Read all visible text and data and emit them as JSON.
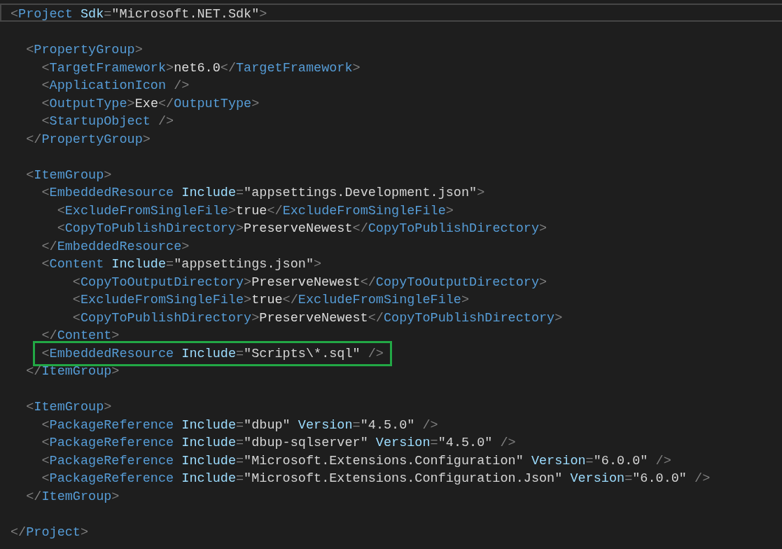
{
  "editor": {
    "lines": [
      {
        "current": true,
        "highlighted": false,
        "tokens": [
          {
            "kind": "punct",
            "text": "<"
          },
          {
            "kind": "element",
            "text": "Project"
          },
          {
            "kind": "attr",
            "text": " Sdk"
          },
          {
            "kind": "punct",
            "text": "="
          },
          {
            "kind": "value",
            "text": "\"Microsoft.NET.Sdk\""
          },
          {
            "kind": "punct",
            "text": ">"
          }
        ]
      },
      {
        "current": false,
        "highlighted": false
      },
      {
        "current": false,
        "highlighted": false,
        "tokens": [
          {
            "kind": "punct",
            "text": "  <"
          },
          {
            "kind": "element",
            "text": "PropertyGroup"
          },
          {
            "kind": "punct",
            "text": ">"
          }
        ]
      },
      {
        "current": false,
        "highlighted": false,
        "tokens": [
          {
            "kind": "punct",
            "text": "    <"
          },
          {
            "kind": "element",
            "text": "TargetFramework"
          },
          {
            "kind": "punct",
            "text": ">"
          },
          {
            "kind": "text",
            "text": "net6.0"
          },
          {
            "kind": "punct",
            "text": "</"
          },
          {
            "kind": "element",
            "text": "TargetFramework"
          },
          {
            "kind": "punct",
            "text": ">"
          }
        ]
      },
      {
        "current": false,
        "highlighted": false,
        "tokens": [
          {
            "kind": "punct",
            "text": "    <"
          },
          {
            "kind": "element",
            "text": "ApplicationIcon"
          },
          {
            "kind": "punct",
            "text": " />"
          }
        ]
      },
      {
        "current": false,
        "highlighted": false,
        "tokens": [
          {
            "kind": "punct",
            "text": "    <"
          },
          {
            "kind": "element",
            "text": "OutputType"
          },
          {
            "kind": "punct",
            "text": ">"
          },
          {
            "kind": "text",
            "text": "Exe"
          },
          {
            "kind": "punct",
            "text": "</"
          },
          {
            "kind": "element",
            "text": "OutputType"
          },
          {
            "kind": "punct",
            "text": ">"
          }
        ]
      },
      {
        "current": false,
        "highlighted": false,
        "tokens": [
          {
            "kind": "punct",
            "text": "    <"
          },
          {
            "kind": "element",
            "text": "StartupObject"
          },
          {
            "kind": "punct",
            "text": " />"
          }
        ]
      },
      {
        "current": false,
        "highlighted": false,
        "tokens": [
          {
            "kind": "punct",
            "text": "  </"
          },
          {
            "kind": "element",
            "text": "PropertyGroup"
          },
          {
            "kind": "punct",
            "text": ">"
          }
        ]
      },
      {
        "current": false,
        "highlighted": false
      },
      {
        "current": false,
        "highlighted": false,
        "tokens": [
          {
            "kind": "punct",
            "text": "  <"
          },
          {
            "kind": "element",
            "text": "ItemGroup"
          },
          {
            "kind": "punct",
            "text": ">"
          }
        ]
      },
      {
        "current": false,
        "highlighted": false,
        "tokens": [
          {
            "kind": "punct",
            "text": "    <"
          },
          {
            "kind": "element",
            "text": "EmbeddedResource"
          },
          {
            "kind": "attr",
            "text": " Include"
          },
          {
            "kind": "punct",
            "text": "="
          },
          {
            "kind": "value",
            "text": "\"appsettings.Development.json\""
          },
          {
            "kind": "punct",
            "text": ">"
          }
        ]
      },
      {
        "current": false,
        "highlighted": false,
        "tokens": [
          {
            "kind": "punct",
            "text": "      <"
          },
          {
            "kind": "element",
            "text": "ExcludeFromSingleFile"
          },
          {
            "kind": "punct",
            "text": ">"
          },
          {
            "kind": "text",
            "text": "true"
          },
          {
            "kind": "punct",
            "text": "</"
          },
          {
            "kind": "element",
            "text": "ExcludeFromSingleFile"
          },
          {
            "kind": "punct",
            "text": ">"
          }
        ]
      },
      {
        "current": false,
        "highlighted": false,
        "tokens": [
          {
            "kind": "punct",
            "text": "      <"
          },
          {
            "kind": "element",
            "text": "CopyToPublishDirectory"
          },
          {
            "kind": "punct",
            "text": ">"
          },
          {
            "kind": "text",
            "text": "PreserveNewest"
          },
          {
            "kind": "punct",
            "text": "</"
          },
          {
            "kind": "element",
            "text": "CopyToPublishDirectory"
          },
          {
            "kind": "punct",
            "text": ">"
          }
        ]
      },
      {
        "current": false,
        "highlighted": false,
        "tokens": [
          {
            "kind": "punct",
            "text": "    </"
          },
          {
            "kind": "element",
            "text": "EmbeddedResource"
          },
          {
            "kind": "punct",
            "text": ">"
          }
        ]
      },
      {
        "current": false,
        "highlighted": false,
        "tokens": [
          {
            "kind": "punct",
            "text": "    <"
          },
          {
            "kind": "element",
            "text": "Content"
          },
          {
            "kind": "attr",
            "text": " Include"
          },
          {
            "kind": "punct",
            "text": "="
          },
          {
            "kind": "value",
            "text": "\"appsettings.json\""
          },
          {
            "kind": "punct",
            "text": ">"
          }
        ]
      },
      {
        "current": false,
        "highlighted": false,
        "tokens": [
          {
            "kind": "punct",
            "text": "        <"
          },
          {
            "kind": "element",
            "text": "CopyToOutputDirectory"
          },
          {
            "kind": "punct",
            "text": ">"
          },
          {
            "kind": "text",
            "text": "PreserveNewest"
          },
          {
            "kind": "punct",
            "text": "</"
          },
          {
            "kind": "element",
            "text": "CopyToOutputDirectory"
          },
          {
            "kind": "punct",
            "text": ">"
          }
        ]
      },
      {
        "current": false,
        "highlighted": false,
        "tokens": [
          {
            "kind": "punct",
            "text": "        <"
          },
          {
            "kind": "element",
            "text": "ExcludeFromSingleFile"
          },
          {
            "kind": "punct",
            "text": ">"
          },
          {
            "kind": "text",
            "text": "true"
          },
          {
            "kind": "punct",
            "text": "</"
          },
          {
            "kind": "element",
            "text": "ExcludeFromSingleFile"
          },
          {
            "kind": "punct",
            "text": ">"
          }
        ]
      },
      {
        "current": false,
        "highlighted": false,
        "tokens": [
          {
            "kind": "punct",
            "text": "        <"
          },
          {
            "kind": "element",
            "text": "CopyToPublishDirectory"
          },
          {
            "kind": "punct",
            "text": ">"
          },
          {
            "kind": "text",
            "text": "PreserveNewest"
          },
          {
            "kind": "punct",
            "text": "</"
          },
          {
            "kind": "element",
            "text": "CopyToPublishDirectory"
          },
          {
            "kind": "punct",
            "text": ">"
          }
        ]
      },
      {
        "current": false,
        "highlighted": false,
        "tokens": [
          {
            "kind": "punct",
            "text": "    </"
          },
          {
            "kind": "element",
            "text": "Content"
          },
          {
            "kind": "punct",
            "text": ">"
          }
        ]
      },
      {
        "current": false,
        "highlighted": true,
        "tokens": [
          {
            "kind": "punct",
            "text": "    <"
          },
          {
            "kind": "element",
            "text": "EmbeddedResource"
          },
          {
            "kind": "attr",
            "text": " Include"
          },
          {
            "kind": "punct",
            "text": "="
          },
          {
            "kind": "value",
            "text": "\"Scripts\\*.sql\""
          },
          {
            "kind": "punct",
            "text": " />"
          }
        ]
      },
      {
        "current": false,
        "highlighted": false,
        "tokens": [
          {
            "kind": "punct",
            "text": "  </"
          },
          {
            "kind": "element",
            "text": "ItemGroup"
          },
          {
            "kind": "punct",
            "text": ">"
          }
        ]
      },
      {
        "current": false,
        "highlighted": false
      },
      {
        "current": false,
        "highlighted": false,
        "tokens": [
          {
            "kind": "punct",
            "text": "  <"
          },
          {
            "kind": "element",
            "text": "ItemGroup"
          },
          {
            "kind": "punct",
            "text": ">"
          }
        ]
      },
      {
        "current": false,
        "highlighted": false,
        "tokens": [
          {
            "kind": "punct",
            "text": "    <"
          },
          {
            "kind": "element",
            "text": "PackageReference"
          },
          {
            "kind": "attr",
            "text": " Include"
          },
          {
            "kind": "punct",
            "text": "="
          },
          {
            "kind": "value",
            "text": "\"dbup\""
          },
          {
            "kind": "attr",
            "text": " Version"
          },
          {
            "kind": "punct",
            "text": "="
          },
          {
            "kind": "value",
            "text": "\"4.5.0\""
          },
          {
            "kind": "punct",
            "text": " />"
          }
        ]
      },
      {
        "current": false,
        "highlighted": false,
        "tokens": [
          {
            "kind": "punct",
            "text": "    <"
          },
          {
            "kind": "element",
            "text": "PackageReference"
          },
          {
            "kind": "attr",
            "text": " Include"
          },
          {
            "kind": "punct",
            "text": "="
          },
          {
            "kind": "value",
            "text": "\"dbup-sqlserver\""
          },
          {
            "kind": "attr",
            "text": " Version"
          },
          {
            "kind": "punct",
            "text": "="
          },
          {
            "kind": "value",
            "text": "\"4.5.0\""
          },
          {
            "kind": "punct",
            "text": " />"
          }
        ]
      },
      {
        "current": false,
        "highlighted": false,
        "tokens": [
          {
            "kind": "punct",
            "text": "    <"
          },
          {
            "kind": "element",
            "text": "PackageReference"
          },
          {
            "kind": "attr",
            "text": " Include"
          },
          {
            "kind": "punct",
            "text": "="
          },
          {
            "kind": "value",
            "text": "\"Microsoft.Extensions.Configuration\""
          },
          {
            "kind": "attr",
            "text": " Version"
          },
          {
            "kind": "punct",
            "text": "="
          },
          {
            "kind": "value",
            "text": "\"6.0.0\""
          },
          {
            "kind": "punct",
            "text": " />"
          }
        ]
      },
      {
        "current": false,
        "highlighted": false,
        "tokens": [
          {
            "kind": "punct",
            "text": "    <"
          },
          {
            "kind": "element",
            "text": "PackageReference"
          },
          {
            "kind": "attr",
            "text": " Include"
          },
          {
            "kind": "punct",
            "text": "="
          },
          {
            "kind": "value",
            "text": "\"Microsoft.Extensions.Configuration.Json\""
          },
          {
            "kind": "attr",
            "text": " Version"
          },
          {
            "kind": "punct",
            "text": "="
          },
          {
            "kind": "value",
            "text": "\"6.0.0\""
          },
          {
            "kind": "punct",
            "text": " />"
          }
        ]
      },
      {
        "current": false,
        "highlighted": false,
        "tokens": [
          {
            "kind": "punct",
            "text": "  </"
          },
          {
            "kind": "element",
            "text": "ItemGroup"
          },
          {
            "kind": "punct",
            "text": ">"
          }
        ]
      },
      {
        "current": false,
        "highlighted": false
      },
      {
        "current": false,
        "highlighted": false,
        "tokens": [
          {
            "kind": "punct",
            "text": "</"
          },
          {
            "kind": "element",
            "text": "Project"
          },
          {
            "kind": "punct",
            "text": ">"
          }
        ]
      }
    ]
  }
}
